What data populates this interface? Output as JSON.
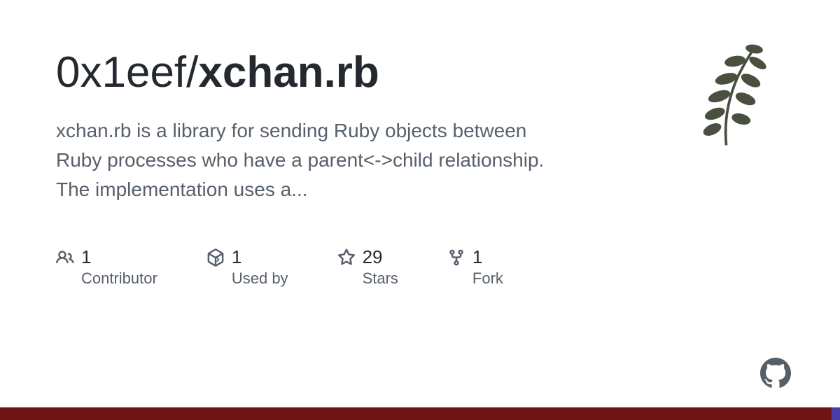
{
  "repo": {
    "owner": "0x1eef",
    "separator": "/",
    "name": "xchan.rb"
  },
  "description": "xchan.rb is a library for sending Ruby objects between Ruby processes who have a parent<->child relationship. The implementation uses a...",
  "stats": {
    "contributors": {
      "value": "1",
      "label": "Contributor"
    },
    "usedby": {
      "value": "1",
      "label": "Used by"
    },
    "stars": {
      "value": "29",
      "label": "Stars"
    },
    "forks": {
      "value": "1",
      "label": "Fork"
    }
  }
}
